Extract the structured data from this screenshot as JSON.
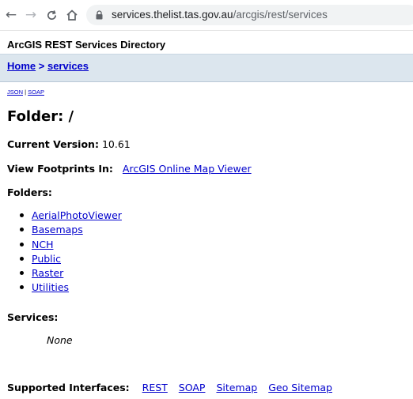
{
  "browser": {
    "url_host": "services.thelist.tas.gov.au",
    "url_path": "/arcgis/rest/services"
  },
  "page": {
    "directory_title": "ArcGIS REST Services Directory",
    "breadcrumb": {
      "home": "Home",
      "separator": ">",
      "current": "services"
    },
    "formats": {
      "json": "JSON",
      "separator": "|",
      "soap": "SOAP"
    },
    "heading": "Folder: /",
    "current_version": {
      "label": "Current Version:",
      "value": "10.61"
    },
    "footprints": {
      "label": "View Footprints In:",
      "link": "ArcGIS Online Map Viewer"
    },
    "folders": {
      "label": "Folders:",
      "items": [
        "AerialPhotoViewer",
        "Basemaps",
        "NCH",
        "Public",
        "Raster",
        "Utilities"
      ]
    },
    "services": {
      "label": "Services:",
      "value": "None"
    },
    "supported_interfaces": {
      "label": "Supported Interfaces:",
      "links": [
        "REST",
        "SOAP",
        "Sitemap",
        "Geo Sitemap"
      ]
    }
  },
  "colors": {
    "link": "#0000cc",
    "breadcrumb_bar": "#dce6ee"
  }
}
